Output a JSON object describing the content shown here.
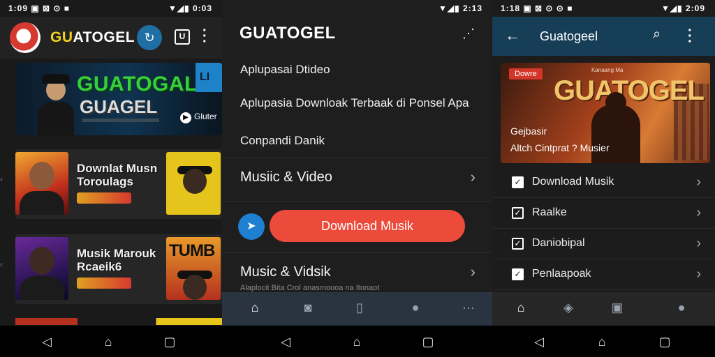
{
  "panel1": {
    "status_left": "1:09 ▣ ⊠ ⊙ ■",
    "status_right": "▼◢▮ 0:03",
    "app_title_gu": "GU",
    "app_title_rest": "ATOGEL",
    "square_icon_label": "U",
    "banner": {
      "title_green": "GUATOGAL",
      "title_white": "GUAGEL",
      "blue_tile_text": "LI",
      "ghbutton_label": "Gluter"
    },
    "cards": [
      {
        "title": "Downlat Musn Toroulags",
        "thumb2_text": ""
      },
      {
        "title": "Musik Marouk Rcaeik6",
        "thumb2_text": "TUMB"
      }
    ]
  },
  "panel2": {
    "status_right": "▼◢▮ 2:13",
    "title": "GUATOGEL",
    "lines": [
      "Aplupasai Dtideo",
      "Aplupasia Downloak Terbaak di Ponsel Apa",
      "Conpandi Danik"
    ],
    "row1_label": "Musiic & Video",
    "download_button": "Download Musik",
    "row2_label": "Music & Vidsik",
    "row2_sub": "Alaplocit Bita Crol anasmoooa na Itonaot"
  },
  "panel3": {
    "status_left": "1:18 ▣ ⊠ ⊙ ⊙ ■",
    "status_right": "▼◢▮ 2:09",
    "title": "Guatogeel",
    "banner": {
      "badge": "Dowre",
      "brand": "Kanaang Ma",
      "big": "GUATOGEL",
      "caption1": "Gejbasir",
      "caption2": "Altch Cintprat ? Musier"
    },
    "rows": [
      {
        "label": "Download Musik",
        "checked": true
      },
      {
        "label": "Raalke",
        "checked": false
      },
      {
        "label": "Daniobipal",
        "checked": false
      },
      {
        "label": "Penlaapoak",
        "checked": true
      }
    ]
  },
  "colors": {
    "accent_red": "#ec4a3a",
    "accent_blue": "#1f7fd1",
    "brand_yellow": "#f4d21c",
    "appbar_blue": "#173e57"
  }
}
